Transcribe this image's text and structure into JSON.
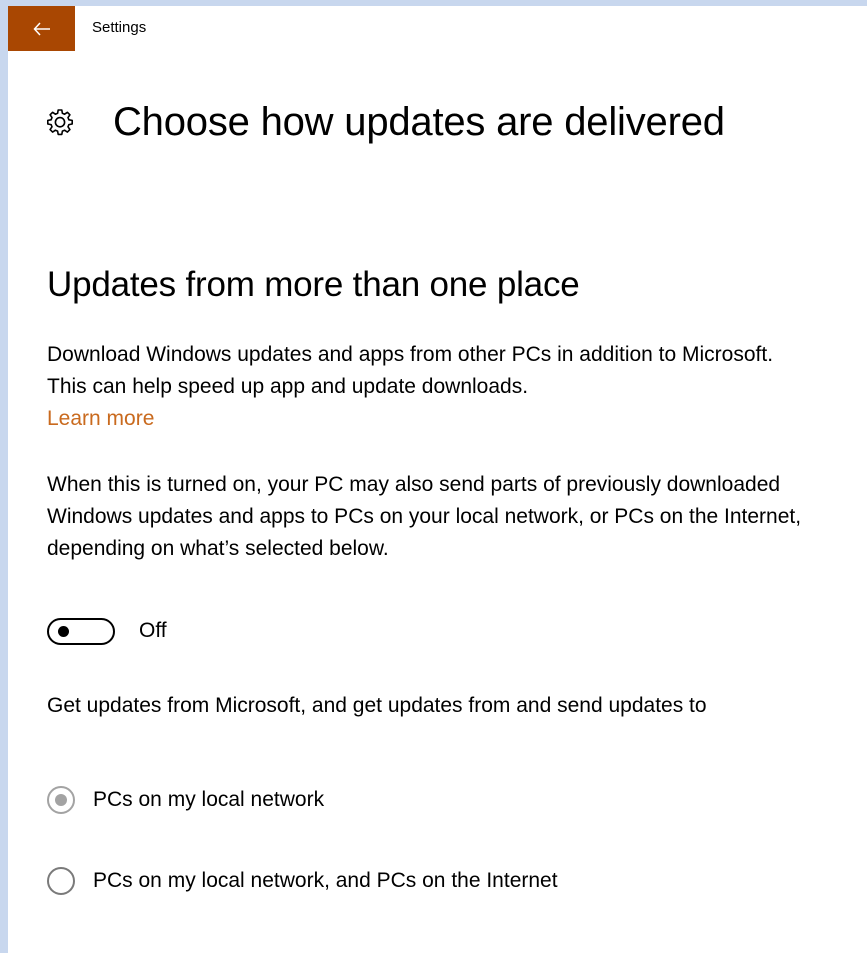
{
  "window": {
    "app_title": "Settings",
    "accent_color": "#a94702",
    "link_color": "#c96a1e"
  },
  "header": {
    "icon": "gear-icon",
    "title": "Choose how updates are delivered"
  },
  "section": {
    "title": "Updates from more than one place",
    "description": "Download Windows updates and apps from other PCs in addition to Microsoft. This can help speed up app and update downloads.",
    "learn_more": "Learn more",
    "warning": "When this is turned on, your PC may also send parts of previously downloaded Windows updates and apps to PCs on your local network, or PCs on the Internet, depending on what’s selected below.",
    "toggle": {
      "state": "off",
      "state_label": "Off"
    },
    "options_intro": "Get updates from Microsoft, and get updates from and send updates to",
    "options": [
      {
        "label": "PCs on my local network",
        "selected": true,
        "enabled": false
      },
      {
        "label": "PCs on my local network, and PCs on the Internet",
        "selected": false,
        "enabled": false
      }
    ]
  }
}
